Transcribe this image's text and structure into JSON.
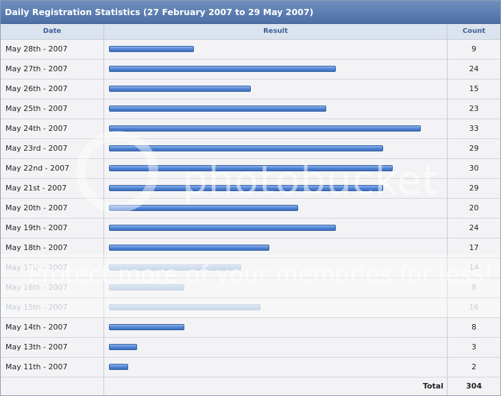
{
  "header": {
    "title": "Daily Registration Statistics (27 February 2007 to 29 May 2007)"
  },
  "columns": {
    "date": "Date",
    "result": "Result",
    "count": "Count"
  },
  "chart_data": {
    "type": "bar",
    "orientation": "horizontal",
    "title": "Daily Registration Statistics (27 February 2007 to 29 May 2007)",
    "categories": [
      "May 28th - 2007",
      "May 27th - 2007",
      "May 26th - 2007",
      "May 25th - 2007",
      "May 24th - 2007",
      "May 23rd - 2007",
      "May 22nd - 2007",
      "May 21st - 2007",
      "May 20th - 2007",
      "May 19th - 2007",
      "May 18th - 2007",
      "May 17th - 2007",
      "May 16th - 2007",
      "May 15th - 2007",
      "May 14th - 2007",
      "May 13th - 2007",
      "May 11th - 2007"
    ],
    "values": [
      9,
      24,
      15,
      23,
      33,
      29,
      30,
      29,
      20,
      24,
      17,
      14,
      8,
      16,
      8,
      3,
      2
    ],
    "xlim": [
      0,
      33
    ]
  },
  "total": {
    "label": "Total",
    "value": "304"
  },
  "watermark": {
    "main": "photobucket",
    "sub": "Protect more of your memories for less!"
  }
}
